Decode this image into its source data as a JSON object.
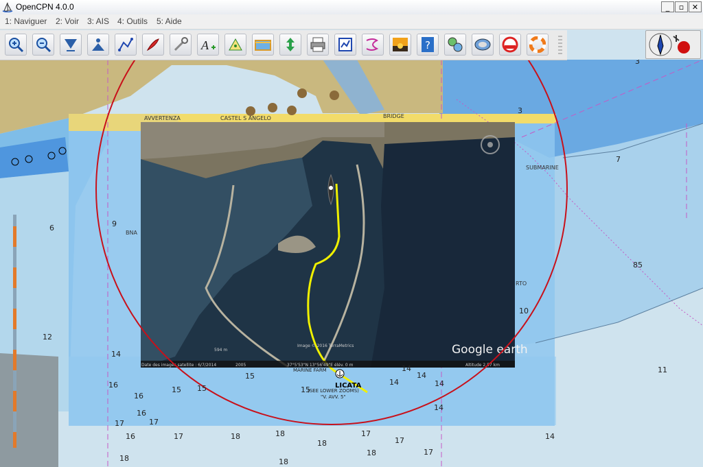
{
  "window": {
    "title": "OpenCPN 4.0.0",
    "controls": {
      "minimize": "_",
      "maximize": "▫",
      "close": "✕"
    }
  },
  "menu": {
    "items": [
      "1: Naviguer",
      "2: Voir",
      "3: AIS",
      "4: Outils",
      "5: Aide"
    ]
  },
  "toolbar": {
    "buttons": [
      "zoom-in-icon",
      "zoom-out-icon",
      "scale-icon",
      "chart-quilt-icon",
      "route-icon",
      "ship-icon",
      "settings-icon",
      "text-icon",
      "layer-icon",
      "tide-icon",
      "current-icon",
      "print-icon",
      "route-manager-icon",
      "track-icon",
      "color-scheme-icon",
      "help-icon",
      "gps-icon",
      "chart-downloader-icon",
      "grib-icon",
      "mob-icon"
    ]
  },
  "chart": {
    "labels": {
      "avvertenza": "AVVERTENZA",
      "castel": "CASTEL S ANGELO",
      "bridge": "BRIDGE",
      "submarine": "SUBMARINE",
      "porto": "RTO",
      "bna": "BNA",
      "marine_farm": "MARINE FARM",
      "licata": "LICATA",
      "see_lower": "(SEE LOWER ZOOMS)",
      "avv": "\"V. AVV. 5\""
    },
    "soundings": [
      "3",
      "3",
      "7",
      "6",
      "12",
      "85",
      "11",
      "14",
      "10",
      "9",
      "14",
      "17",
      "17",
      "17",
      "18",
      "18",
      "18",
      "18",
      "17",
      "17",
      "17",
      "16",
      "16",
      "16",
      "15",
      "15",
      "15",
      "15",
      "14",
      "14",
      "14",
      "14",
      "14",
      "16",
      "18",
      "18"
    ],
    "earth": {
      "logo": "Google earth",
      "footer_left": "Date des images satellite : 6/7/2014",
      "footer_year": "2005",
      "footer_coords": "37°5'53\"N  13°56'49\"E  élév. 0 m",
      "footer_alt": "Altitude 2.57 km",
      "scale": "594 m",
      "credit": "Image © 2016 TerraMetrics"
    }
  },
  "colors": {
    "land": "#c9b87f",
    "shallow": "#6fb0e5",
    "medium": "#9fd0ef",
    "deep": "#c9e1ef",
    "range_ring": "#c8101a",
    "track": "#f0f000"
  }
}
